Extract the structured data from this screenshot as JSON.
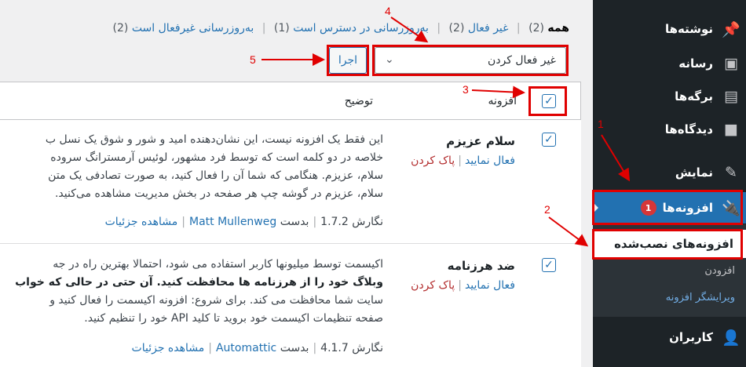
{
  "sidebar": {
    "items": [
      {
        "label": "نوشته‌ها",
        "icon": "pin-icon"
      },
      {
        "label": "رسانه",
        "icon": "media-icon"
      },
      {
        "label": "برگه‌ها",
        "icon": "pages-icon"
      },
      {
        "label": "دیدگاه‌ها",
        "icon": "comments-icon"
      },
      {
        "label": "نمایش",
        "icon": "appearance-icon"
      },
      {
        "label": "افزونه‌ها",
        "icon": "plugins-icon",
        "badge": "1"
      },
      {
        "label": "کاربران",
        "icon": "users-icon"
      }
    ],
    "submenu": {
      "installed": "افزونه‌های نصب‌شده",
      "add": "افزودن",
      "editor": "ویرایشگر افزونه"
    }
  },
  "views": {
    "all_label": "همه",
    "all_count": "(2)",
    "inactive_label": "غیر فعال",
    "inactive_count": "(2)",
    "update_label": "به‌روزرسانی در دسترس است",
    "update_count": "(1)",
    "autoupdate_label": "به‌روزرسانی غیرفعال است",
    "autoupdate_count": "(2)"
  },
  "bulk": {
    "selected_action": "غیر فعال کردن",
    "apply_label": "اجرا"
  },
  "table": {
    "col_plugin": "افزونه",
    "col_description": "توضیح",
    "rows": [
      {
        "name": "سلام عزیزم",
        "activate": "فعال نمایید",
        "delete": "پاک کردن",
        "desc_lines": [
          "این فقط یک افزونه نیست، این نشان‌دهنده امید و شور و شوق یک نسل ب",
          "خلاصه در دو کلمه است که توسط فرد مشهور، لوئیس آرمسترانگ سروده",
          "سلام، عزیزم. هنگامی که شما آن را فعال کنید، به صورت تصادفی یک متن",
          "سلام، عزیزم در گوشه چپ هر صفحه در بخش مدیریت مشاهده می‌کنید."
        ],
        "version": "نگارش 1.7.2",
        "by": "بدست",
        "author": "Matt Mullenweg",
        "details": "مشاهده جزئیات"
      },
      {
        "name": "ضد هرزنامه",
        "activate": "فعال نمایید",
        "delete": "پاک کردن",
        "desc_lines": [
          "اکیسمت توسط میلیونها کاربر استفاده می شود، احتمالا بهترین راه در جه",
          "وبلاگ خود را از هرزنامه ها محافظت کنید. آن حتی در حالی که خواب",
          "سایت شما محافظت می کند. برای شروع: افزونه اکیسمت را فعال کنید و",
          "صفحه تنظیمات اکیسمت خود بروید تا کلید API خود را تنظیم کنید."
        ],
        "version": "نگارش 4.1.7",
        "by": "بدست",
        "author": "Automattic",
        "details": "مشاهده جزئیات"
      }
    ]
  },
  "annotations": [
    "1",
    "2",
    "3",
    "4",
    "5"
  ],
  "colors": {
    "sidebar": "#1d2327",
    "active": "#2271b1",
    "highlight": "#e00000",
    "link": "#2271b1",
    "delete": "#b32d2e"
  }
}
